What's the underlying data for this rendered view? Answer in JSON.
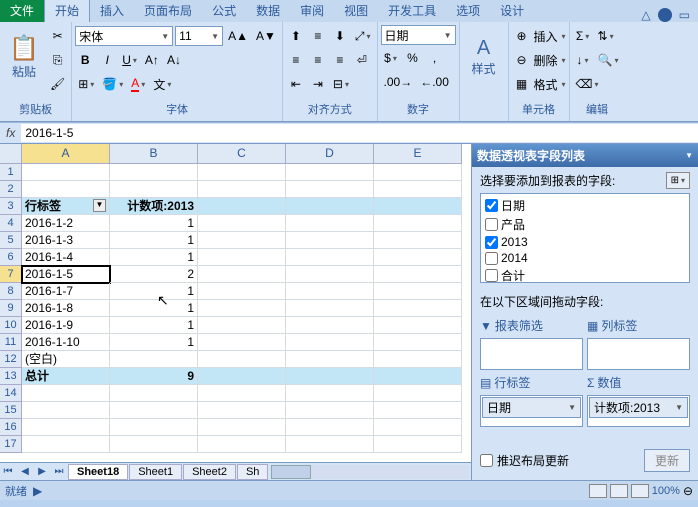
{
  "tabs": {
    "file": "文件",
    "items": [
      "开始",
      "插入",
      "页面布局",
      "公式",
      "数据",
      "审阅",
      "视图",
      "开发工具",
      "选项",
      "设计"
    ],
    "active_index": 0
  },
  "ribbon": {
    "clipboard": {
      "paste": "粘贴",
      "label": "剪贴板"
    },
    "font": {
      "name": "宋体",
      "size": "11",
      "label": "字体"
    },
    "alignment": {
      "label": "对齐方式"
    },
    "number": {
      "format": "日期",
      "label": "数字"
    },
    "styles": {
      "btn": "样式",
      "label": ""
    },
    "cells": {
      "insert": "插入",
      "delete": "删除",
      "format": "格式",
      "label": "单元格"
    },
    "editing": {
      "label": "编辑"
    }
  },
  "formula": {
    "value": "2016-1-5"
  },
  "sheet": {
    "columns": [
      "A",
      "B",
      "C",
      "D",
      "E"
    ],
    "active_col": 0,
    "active_row": 7,
    "rows": [
      {
        "n": 1,
        "cells": [
          "",
          "",
          "",
          "",
          ""
        ]
      },
      {
        "n": 2,
        "cells": [
          "",
          "",
          "",
          "",
          ""
        ]
      },
      {
        "n": 3,
        "cells": [
          "行标签",
          "计数项:2013",
          "",
          "",
          ""
        ],
        "header": true
      },
      {
        "n": 4,
        "cells": [
          "2016-1-2",
          "1",
          "",
          "",
          ""
        ]
      },
      {
        "n": 5,
        "cells": [
          "2016-1-3",
          "1",
          "",
          "",
          ""
        ]
      },
      {
        "n": 6,
        "cells": [
          "2016-1-4",
          "1",
          "",
          "",
          ""
        ]
      },
      {
        "n": 7,
        "cells": [
          "2016-1-5",
          "2",
          "",
          "",
          ""
        ],
        "selected": true
      },
      {
        "n": 8,
        "cells": [
          "2016-1-7",
          "1",
          "",
          "",
          ""
        ]
      },
      {
        "n": 9,
        "cells": [
          "2016-1-8",
          "1",
          "",
          "",
          ""
        ]
      },
      {
        "n": 10,
        "cells": [
          "2016-1-9",
          "1",
          "",
          "",
          ""
        ]
      },
      {
        "n": 11,
        "cells": [
          "2016-1-10",
          "1",
          "",
          "",
          ""
        ]
      },
      {
        "n": 12,
        "cells": [
          "(空白)",
          "",
          "",
          "",
          ""
        ]
      },
      {
        "n": 13,
        "cells": [
          "总计",
          "9",
          "",
          "",
          ""
        ],
        "total": true
      },
      {
        "n": 14,
        "cells": [
          "",
          "",
          "",
          "",
          ""
        ]
      },
      {
        "n": 15,
        "cells": [
          "",
          "",
          "",
          "",
          ""
        ]
      },
      {
        "n": 16,
        "cells": [
          "",
          "",
          "",
          "",
          ""
        ]
      },
      {
        "n": 17,
        "cells": [
          "",
          "",
          "",
          "",
          ""
        ]
      }
    ],
    "tabs": [
      "Sheet18",
      "Sheet1",
      "Sheet2",
      "Sh"
    ],
    "active_tab": 0
  },
  "pivot": {
    "title": "数据透视表字段列表",
    "choose_label": "选择要添加到报表的字段:",
    "fields": [
      {
        "name": "日期",
        "checked": true
      },
      {
        "name": "产品",
        "checked": false
      },
      {
        "name": "2013",
        "checked": true
      },
      {
        "name": "2014",
        "checked": false
      },
      {
        "name": "合计",
        "checked": false
      }
    ],
    "drag_label": "在以下区域间拖动字段:",
    "zones": {
      "filter": "报表筛选",
      "columns": "列标签",
      "rows": "行标签",
      "values": "数值"
    },
    "row_item": "日期",
    "value_item": "计数项:2013",
    "defer": "推迟布局更新",
    "update": "更新"
  },
  "status": {
    "ready": "就绪",
    "zoom": "100%"
  }
}
